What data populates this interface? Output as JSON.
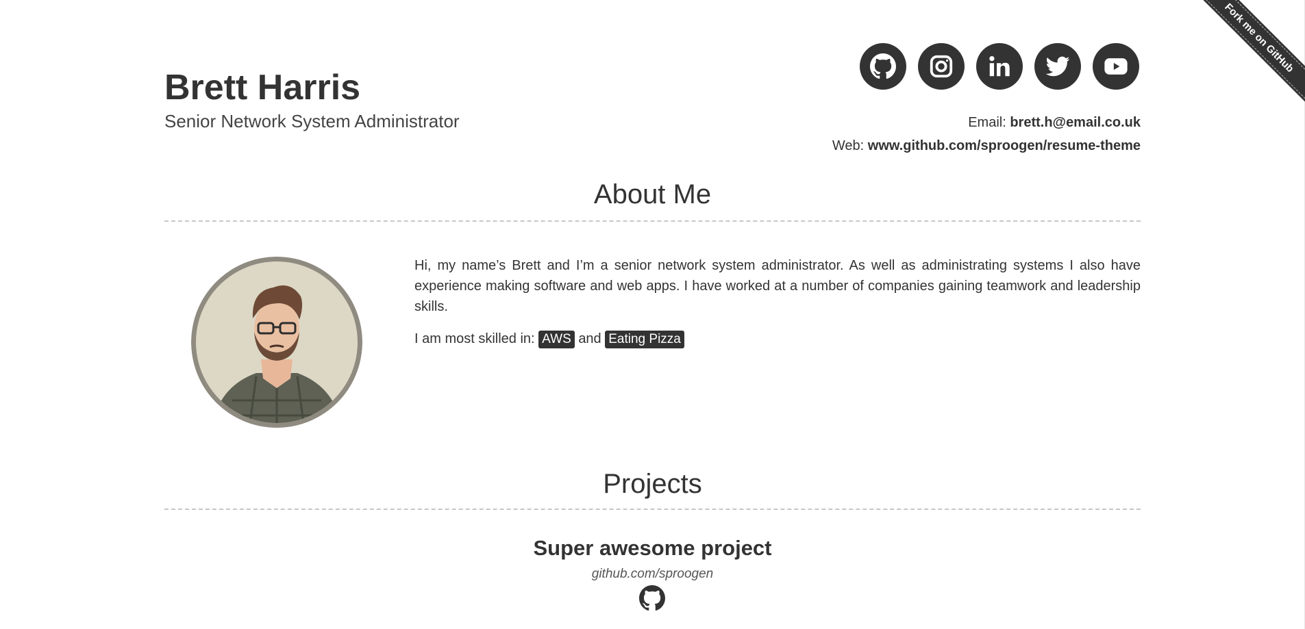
{
  "header": {
    "name": "Brett Harris",
    "role": "Senior Network System Administrator",
    "email_label": "Email:",
    "email_value": "brett.h@email.co.uk",
    "web_label": "Web:",
    "web_value": "www.github.com/sproogen/resume-theme"
  },
  "socials": [
    {
      "icon": "github-icon"
    },
    {
      "icon": "instagram-icon"
    },
    {
      "icon": "linkedin-icon"
    },
    {
      "icon": "twitter-icon"
    },
    {
      "icon": "youtube-icon"
    }
  ],
  "ribbon": {
    "label": "Fork me on GitHub"
  },
  "about": {
    "title": "About Me",
    "text": "Hi, my name’s Brett and I’m a senior network system administrator. As well as administrating systems I also have experience making software and web apps. I have worked at a number of companies gaining teamwork and leadership skills.",
    "skills_prefix": "I am most skilled in:",
    "skills": [
      "AWS",
      "Eating Pizza"
    ],
    "skills_joiner": "and"
  },
  "projects": {
    "title": "Projects",
    "items": [
      {
        "name": "Super awesome project",
        "link": "github.com/sproogen",
        "icon": "github-icon"
      }
    ]
  },
  "colors": {
    "text": "#333333",
    "accent_dark": "#333333",
    "rule": "#c7c7c7",
    "background": "#ffffff"
  }
}
